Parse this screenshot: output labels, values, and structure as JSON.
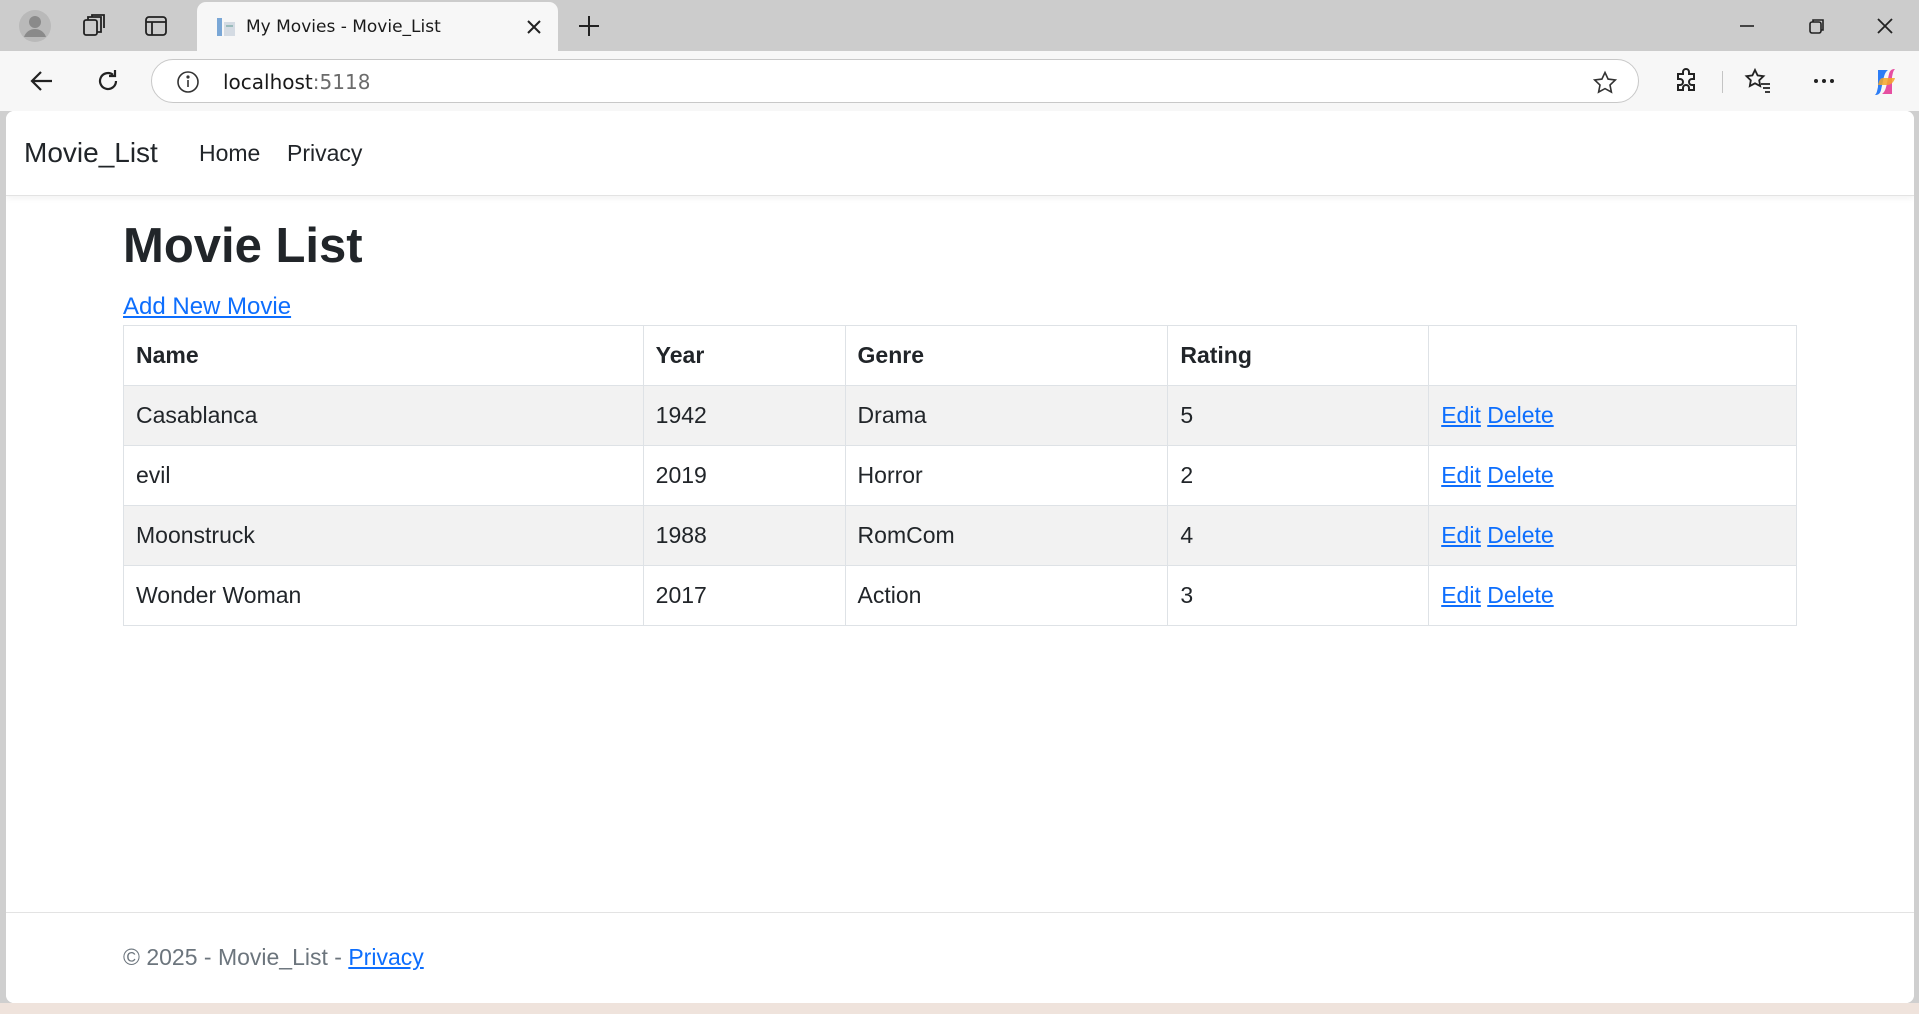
{
  "browser": {
    "tab_title": "My Movies - Movie_List",
    "address_host": "localhost",
    "address_port": ":5118"
  },
  "site": {
    "brand": "Movie_List",
    "nav": [
      "Home",
      "Privacy"
    ]
  },
  "main": {
    "title": "Movie List",
    "add_link": "Add New Movie",
    "table": {
      "headers": [
        "Name",
        "Year",
        "Genre",
        "Rating",
        ""
      ],
      "rows": [
        {
          "name": "Casablanca",
          "year": "1942",
          "genre": "Drama",
          "rating": "5"
        },
        {
          "name": "evil",
          "year": "2019",
          "genre": "Horror",
          "rating": "2"
        },
        {
          "name": "Moonstruck",
          "year": "1988",
          "genre": "RomCom",
          "rating": "4"
        },
        {
          "name": "Wonder Woman",
          "year": "2017",
          "genre": "Action",
          "rating": "3"
        }
      ],
      "edit_label": "Edit",
      "delete_label": "Delete"
    }
  },
  "footer": {
    "text": "© 2025 - Movie_List - ",
    "link": "Privacy"
  },
  "colors": {
    "link": "#0d6efd",
    "text": "#212529",
    "stripe": "#f2f2f2",
    "muted": "#6c757d"
  },
  "icons": [
    "profile-icon",
    "workspaces-icon",
    "tab-actions-icon",
    "page-favicon-icon",
    "close-tab-icon",
    "new-tab-icon",
    "minimize-icon",
    "restore-icon",
    "close-window-icon",
    "back-icon",
    "reload-icon",
    "info-icon",
    "favorite-star-icon",
    "extensions-icon",
    "favorites-icon",
    "more-icon",
    "copilot-icon"
  ]
}
